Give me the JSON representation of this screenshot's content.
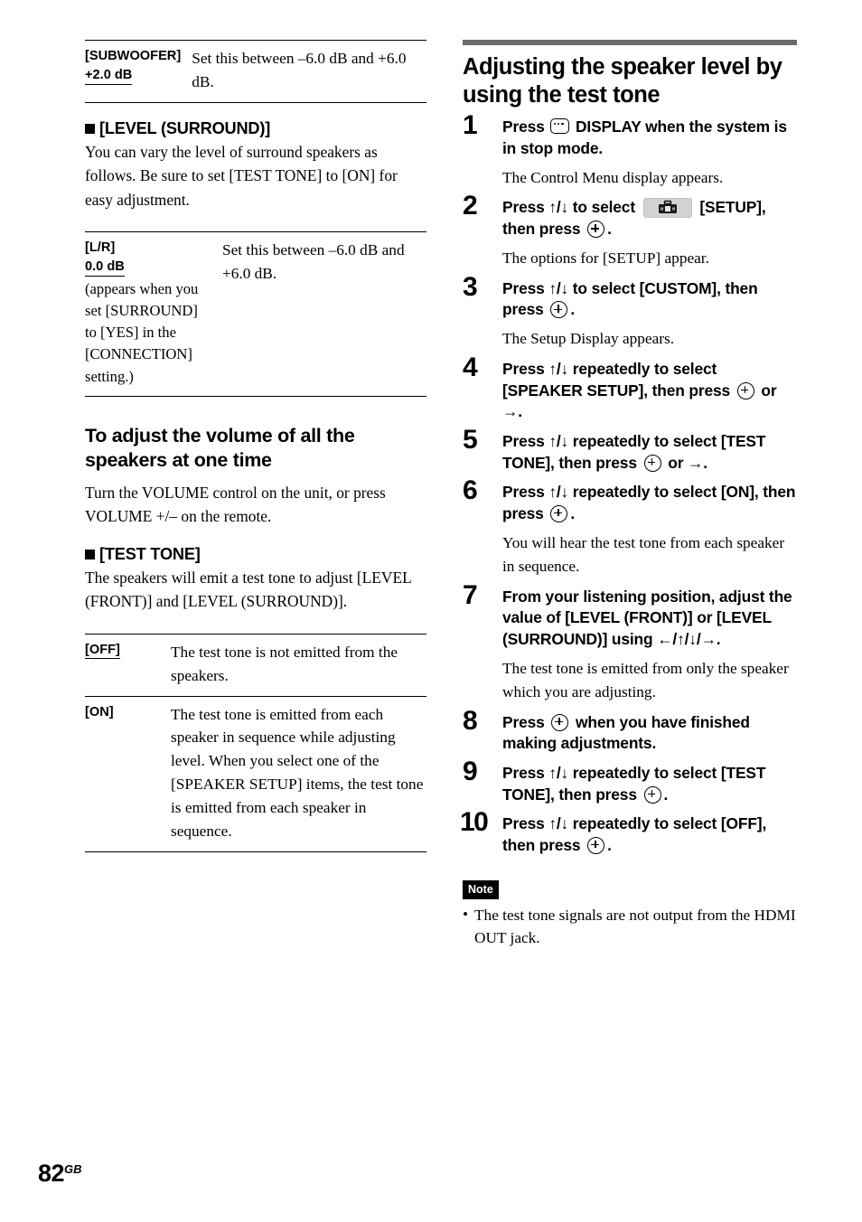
{
  "left_column": {
    "subwoofer_table": {
      "rows": [
        {
          "key_main": "[SUBWOOFER]",
          "key_default": "+2.0 dB",
          "value": "Set this between –6.0 dB and +6.0 dB."
        }
      ]
    },
    "level_surround": {
      "heading": "[LEVEL (SURROUND)]",
      "body": "You can vary the level of surround speakers as follows. Be sure to set [TEST TONE] to [ON] for easy adjustment."
    },
    "lr_table": {
      "rows": [
        {
          "key_main": "[L/R]",
          "key_default": "0.0 dB",
          "key_note": "(appears when you set [SURROUND] to [YES] in the [CONNECTION] setting.)",
          "value": "Set this between –6.0 dB and +6.0 dB."
        }
      ]
    },
    "volume_section": {
      "heading": "To adjust the volume of all the speakers at one time",
      "body": "Turn the VOLUME control on the unit, or press VOLUME +/– on the remote."
    },
    "test_tone": {
      "heading": "[TEST TONE]",
      "body": "The speakers will emit a test tone to adjust [LEVEL (FRONT)] and [LEVEL (SURROUND)].",
      "table_rows": [
        {
          "key": "[OFF]",
          "key_underlined": true,
          "value": "The test tone is not emitted from the speakers."
        },
        {
          "key": "[ON]",
          "key_underlined": false,
          "value": "The test tone is emitted from each speaker in sequence while adjusting level. When you select one of the [SPEAKER SETUP] items, the test tone is emitted from each speaker in sequence."
        }
      ]
    }
  },
  "right_column": {
    "section_title": "Adjusting the speaker level by using the test tone",
    "steps": [
      {
        "num": "1",
        "head_before": "Press",
        "icon": "display-icon",
        "head_after": "DISPLAY when the system is in stop mode.",
        "body": "The Control Menu display appears."
      },
      {
        "num": "2",
        "head_before": "Press ↑/↓ to select",
        "icon": "setup-toolbox-icon",
        "head_after": "[SETUP], then press",
        "head_end_icon": "enter-icon",
        "head_end": ".",
        "body": "The options for [SETUP] appear."
      },
      {
        "num": "3",
        "head_before": "Press ↑/↓ to select [CUSTOM], then press",
        "head_end_icon": "enter-icon",
        "head_end": ".",
        "body": "The Setup Display appears."
      },
      {
        "num": "4",
        "head_before": "Press ↑/↓ repeatedly to select [SPEAKER SETUP], then press",
        "head_end_icon": "enter-icon",
        "head_end": "or →.",
        "body": ""
      },
      {
        "num": "5",
        "head_before": "Press ↑/↓ repeatedly to select [TEST TONE], then press",
        "head_end_icon": "enter-icon",
        "head_end": "or →.",
        "body": ""
      },
      {
        "num": "6",
        "head_before": "Press ↑/↓ repeatedly to select [ON], then press",
        "head_end_icon": "enter-icon",
        "head_end": ".",
        "body": "You will hear the test tone from each speaker in sequence."
      },
      {
        "num": "7",
        "head_before": "From your listening position, adjust the value of [LEVEL (FRONT)] or [LEVEL (SURROUND)] using ←/↑/↓/→.",
        "body": "The test tone is emitted from only the speaker which you are adjusting."
      },
      {
        "num": "8",
        "head_before": "Press",
        "head_end_icon": "enter-icon",
        "head_end": "when you have finished making adjustments.",
        "body": ""
      },
      {
        "num": "9",
        "head_before": "Press ↑/↓ repeatedly to select [TEST TONE], then press",
        "head_end_icon": "enter-icon",
        "head_end": ".",
        "body": ""
      },
      {
        "num": "10",
        "head_before": "Press ↑/↓ repeatedly to select [OFF], then press",
        "head_end_icon": "enter-icon",
        "head_end": ".",
        "body": ""
      }
    ],
    "note": {
      "badge": "Note",
      "items": [
        "The test tone signals are not output from the HDMI OUT jack."
      ]
    }
  },
  "footer": {
    "page_number": "82",
    "page_suffix": "GB"
  },
  "colors": {
    "rule_gray": "#6b6b6b",
    "text": "#000000",
    "icon_chip_bg": "#d2d2d2"
  }
}
